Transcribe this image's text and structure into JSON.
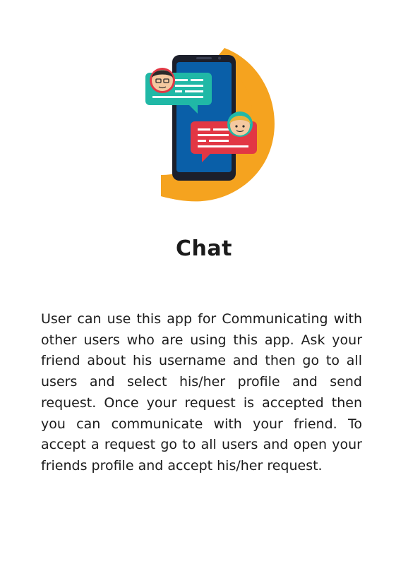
{
  "screen": {
    "title": "Chat",
    "description": "User can use this app for Communicating with other users who are using this app. Ask your friend about his username and then go to all users and select his/her profile and send request. Once your request is accepted then you can communicate with your friend. To accept a request go to all users and open your friends profile and accept his/her request."
  },
  "illustration": {
    "icon": "chat-illustration",
    "colors": {
      "orange": "#F5A31F",
      "phone": "#1C1F2B",
      "screen": "#0A5FA8",
      "teal_bubble": "#20B8A6",
      "red_bubble": "#E23744"
    }
  }
}
